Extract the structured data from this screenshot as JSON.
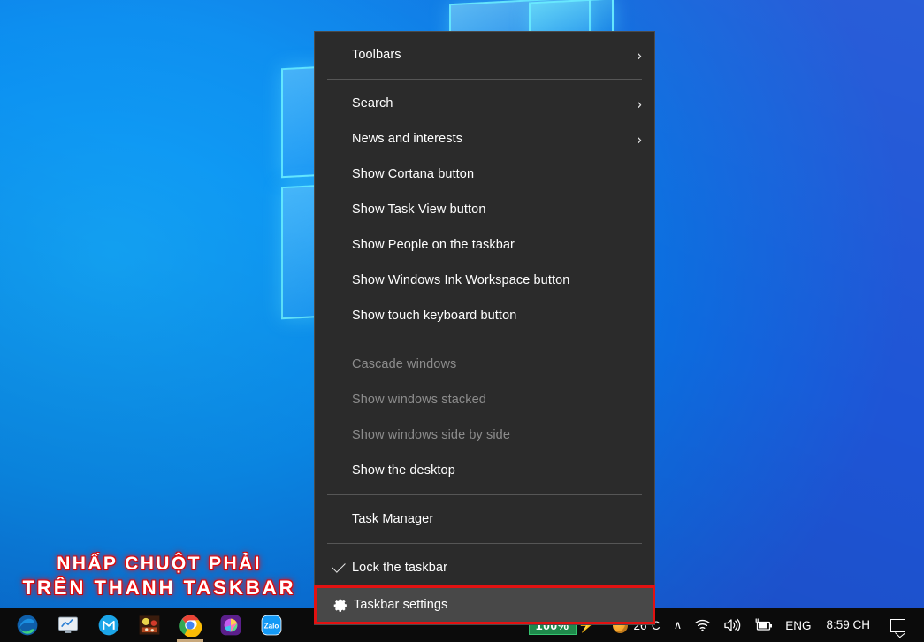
{
  "desktop": {
    "wallpaper_name": "windows-10-hero-wallpaper",
    "colors": {
      "blue_light": "#13a4f7",
      "blue_deep": "#1640c4",
      "pane_edge": "#69f0ff"
    }
  },
  "overlay_caption": {
    "line1": "NHẤP CHUỘT PHẢI",
    "line2": "TRÊN THANH TASKBAR",
    "text_color": "#ffffff",
    "outline_color": "#ff1414"
  },
  "context_menu": {
    "name": "taskbar-context-menu",
    "background": "#2b2b2b",
    "border_color": "#4a4a4a",
    "highlight_color": "#484848",
    "highlight_border": "#e21212",
    "groups": [
      {
        "items": [
          {
            "label": "Toolbars",
            "icon": "",
            "submenu": true,
            "disabled": false,
            "checked": false,
            "highlighted": false
          }
        ]
      },
      {
        "items": [
          {
            "label": "Search",
            "icon": "",
            "submenu": true,
            "disabled": false,
            "checked": false,
            "highlighted": false
          },
          {
            "label": "News and interests",
            "icon": "",
            "submenu": true,
            "disabled": false,
            "checked": false,
            "highlighted": false
          },
          {
            "label": "Show Cortana button",
            "icon": "",
            "submenu": false,
            "disabled": false,
            "checked": false,
            "highlighted": false
          },
          {
            "label": "Show Task View button",
            "icon": "",
            "submenu": false,
            "disabled": false,
            "checked": false,
            "highlighted": false
          },
          {
            "label": "Show People on the taskbar",
            "icon": "",
            "submenu": false,
            "disabled": false,
            "checked": false,
            "highlighted": false
          },
          {
            "label": "Show Windows Ink Workspace button",
            "icon": "",
            "submenu": false,
            "disabled": false,
            "checked": false,
            "highlighted": false
          },
          {
            "label": "Show touch keyboard button",
            "icon": "",
            "submenu": false,
            "disabled": false,
            "checked": false,
            "highlighted": false
          }
        ]
      },
      {
        "items": [
          {
            "label": "Cascade windows",
            "icon": "",
            "submenu": false,
            "disabled": true,
            "checked": false,
            "highlighted": false
          },
          {
            "label": "Show windows stacked",
            "icon": "",
            "submenu": false,
            "disabled": true,
            "checked": false,
            "highlighted": false
          },
          {
            "label": "Show windows side by side",
            "icon": "",
            "submenu": false,
            "disabled": true,
            "checked": false,
            "highlighted": false
          },
          {
            "label": "Show the desktop",
            "icon": "",
            "submenu": false,
            "disabled": false,
            "checked": false,
            "highlighted": false
          }
        ]
      },
      {
        "items": [
          {
            "label": "Task Manager",
            "icon": "",
            "submenu": false,
            "disabled": false,
            "checked": false,
            "highlighted": false
          }
        ]
      },
      {
        "items": [
          {
            "label": "Lock the taskbar",
            "icon": "check-icon",
            "submenu": false,
            "disabled": false,
            "checked": true,
            "highlighted": false
          },
          {
            "label": "Taskbar settings",
            "icon": "gear-icon",
            "submenu": false,
            "disabled": false,
            "checked": false,
            "highlighted": true
          }
        ]
      }
    ],
    "submenu_arrow": "›"
  },
  "taskbar": {
    "background": "#0b0b0b",
    "apps": [
      {
        "name": "microsoft-edge",
        "label": "Microsoft Edge",
        "active": false
      },
      {
        "name": "chart-monitor-app",
        "label": "Chart Monitor",
        "active": false
      },
      {
        "name": "blue-m-app",
        "label": "M App",
        "active": false
      },
      {
        "name": "game-app",
        "label": "Game",
        "active": false
      },
      {
        "name": "google-chrome",
        "label": "Google Chrome",
        "active": true
      },
      {
        "name": "purple-circle-app",
        "label": "Purple App",
        "active": false
      },
      {
        "name": "zalo",
        "label": "Zalo",
        "active": false
      }
    ],
    "tray": {
      "battery_percent": "100%",
      "charging_bolt": "⚡",
      "weather_temp": "26°C",
      "show_hidden_icons": "∧",
      "network_icon": "wifi-icon",
      "volume_icon": "speaker-icon",
      "battery_icon": "battery-charging-icon",
      "language": "ENG",
      "clock_time": "8:59 CH",
      "action_center_icon": "notification-icon"
    }
  }
}
